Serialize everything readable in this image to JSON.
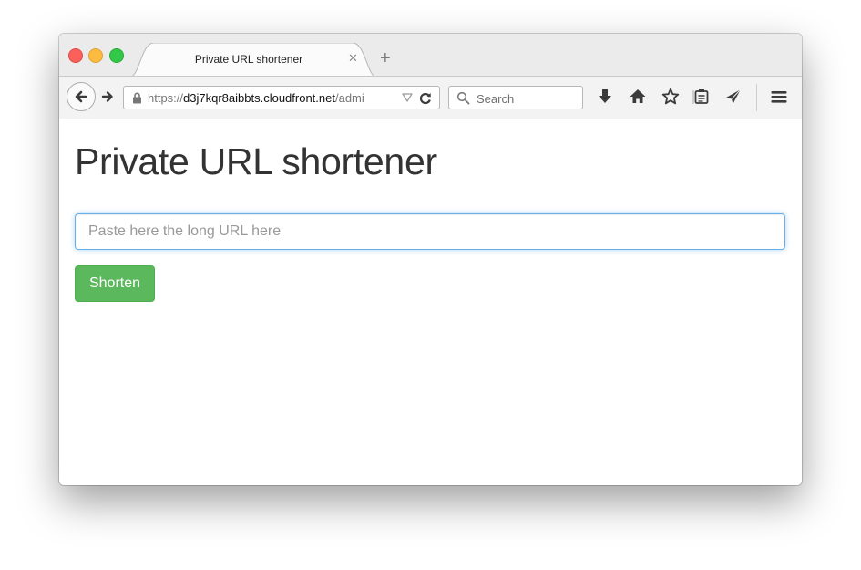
{
  "browser": {
    "tab": {
      "title": "Private URL shortener",
      "close_glyph": "✕",
      "new_tab_glyph": "+"
    },
    "url": {
      "prefix": "https://",
      "host": "d3j7kqr8aibbts.cloudfront.net",
      "path": "/admi"
    },
    "search": {
      "placeholder": "Search"
    },
    "toolbar_icons": [
      "download-icon",
      "home-icon",
      "bookmark-star-icon",
      "reading-list-icon",
      "share-icon",
      "menu-icon"
    ],
    "traffic_lights": {
      "close": "#fc605c",
      "minimize": "#fdbc40",
      "maximize": "#34c84a"
    }
  },
  "page": {
    "title": "Private URL shortener",
    "url_input": {
      "placeholder": "Paste here the long URL here",
      "value": ""
    },
    "shorten_button": {
      "label": "Shorten"
    }
  },
  "colors": {
    "accent_button": "#5cb85c",
    "input_focus": "#66afe9",
    "heading": "#333333"
  }
}
